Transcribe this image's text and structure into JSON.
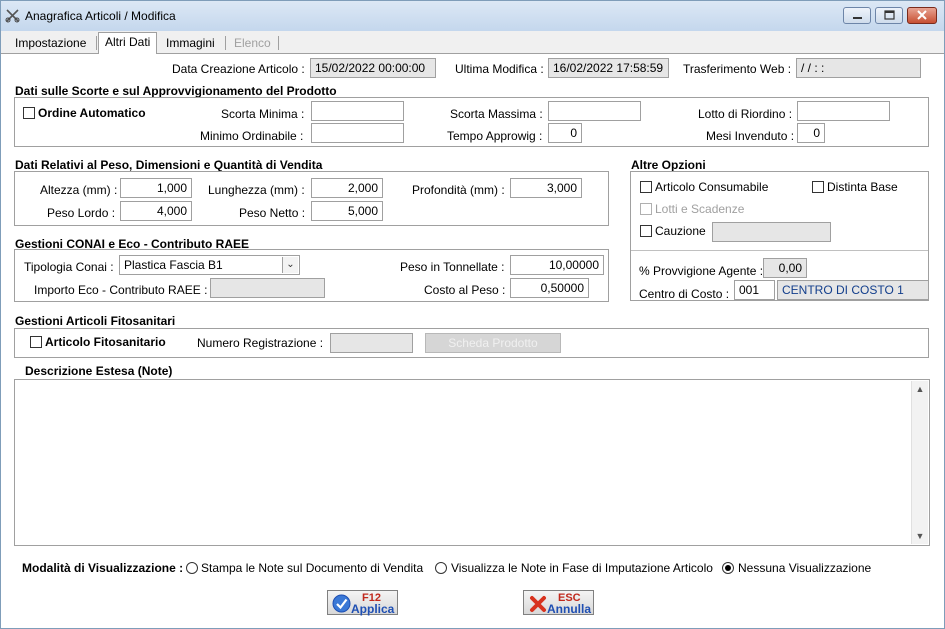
{
  "window": {
    "title": "Anagrafica Articoli / Modifica",
    "app_icon": "scissors-icon",
    "minimize_icon": "minimize-icon",
    "maximize_icon": "maximize-icon",
    "close_icon": "close-icon"
  },
  "tabs": [
    {
      "label": "Impostazione",
      "state": "normal"
    },
    {
      "label": "Altri Dati",
      "state": "active"
    },
    {
      "label": "Immagini",
      "state": "normal"
    },
    {
      "label": "Elenco",
      "state": "disabled"
    }
  ],
  "header": {
    "creation_label": "Data Creazione Articolo :",
    "creation_value": "15/02/2022 00:00:00",
    "last_mod_label": "Ultima Modifica :",
    "last_mod_value": "16/02/2022 17:58:59",
    "web_label": "Trasferimento Web :",
    "web_value": "/ /     : :"
  },
  "stock": {
    "title": "Dati sulle Scorte e sul Approvvigionamento del Prodotto",
    "auto_order_label": "Ordine Automatico",
    "auto_order_checked": false,
    "min_stock_label": "Scorta Minima :",
    "min_stock_value": "",
    "max_stock_label": "Scorta Massima :",
    "max_stock_value": "",
    "reorder_lot_label": "Lotto di Riordino :",
    "reorder_lot_value": "",
    "min_order_label": "Minimo Ordinabile :",
    "min_order_value": "",
    "supply_time_label": "Tempo Approwig :",
    "supply_time_value": "0",
    "unsold_months_label": "Mesi Invenduto :",
    "unsold_months_value": "0"
  },
  "dimensions": {
    "title": "Dati Relativi al Peso, Dimensioni e Quantità di Vendita",
    "height_label": "Altezza (mm) :",
    "height_value": "1,000",
    "length_label": "Lunghezza (mm) :",
    "length_value": "2,000",
    "depth_label": "Profondità (mm) :",
    "depth_value": "3,000",
    "gross_label": "Peso Lordo :",
    "gross_value": "4,000",
    "net_label": "Peso Netto :",
    "net_value": "5,000"
  },
  "other_options": {
    "title": "Altre Opzioni",
    "consumable_label": "Articolo Consumabile",
    "consumable_checked": false,
    "bom_label": "Distinta Base",
    "bom_checked": false,
    "lots_label": "Lotti e Scadenze",
    "lots_checked": false,
    "deposit_label": "Cauzione",
    "deposit_checked": false,
    "deposit_value": "",
    "commission_label": "% Provvigione Agente :",
    "commission_value": "0,00",
    "cost_center_label": "Centro di Costo :",
    "cost_center_code": "001",
    "cost_center_name": "CENTRO DI COSTO 1"
  },
  "conai": {
    "title": "Gestioni CONAI e Eco - Contributo RAEE",
    "type_label": "Tipologia Conai :",
    "type_value": "Plastica Fascia B1",
    "dropdown_icon": "chevron-down-icon",
    "tons_label": "Peso in Tonnellate :",
    "tons_value": "10,00000",
    "eco_label": "Importo Eco - Contributo RAEE :",
    "eco_value": "",
    "cost_weight_label": "Costo al Peso :",
    "cost_weight_value": "0,50000"
  },
  "phyto": {
    "title": "Gestioni Articoli Fitosanitari",
    "item_label": "Articolo Fitosanitario",
    "item_checked": false,
    "reg_label": "Numero Registrazione :",
    "reg_value": "",
    "sheet_button": "Scheda Prodotto"
  },
  "notes": {
    "title": "Descrizione Estesa (Note)",
    "text": "",
    "scroll_up_icon": "scroll-up-icon",
    "scroll_down_icon": "scroll-down-icon"
  },
  "display_mode": {
    "label": "Modalità di Visualizzazione :",
    "options": [
      {
        "label": "Stampa le Note sul Documento di Vendita",
        "selected": false
      },
      {
        "label": "Visualizza le Note in Fase di Imputazione Articolo",
        "selected": false
      },
      {
        "label": "Nessuna Visualizzazione",
        "selected": true
      }
    ]
  },
  "footer": {
    "apply_key": "F12",
    "apply_label": "Applica",
    "apply_icon": "check-icon",
    "cancel_key": "ESC",
    "cancel_label": "Annulla",
    "cancel_icon": "x-icon",
    "apply_color": "#1f4fb3",
    "cancel_color": "#c0281c"
  }
}
